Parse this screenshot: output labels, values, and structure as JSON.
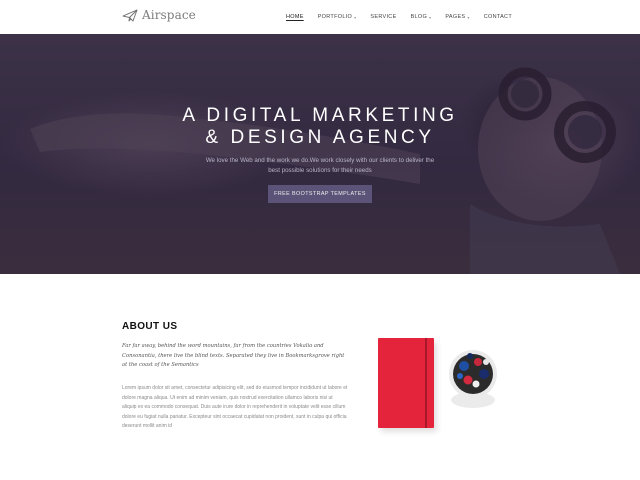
{
  "header": {
    "logo_text": "Airspace",
    "nav": [
      {
        "label": "HOME",
        "active": true,
        "dropdown": false
      },
      {
        "label": "PORTFOLIO",
        "active": false,
        "dropdown": true
      },
      {
        "label": "SERVICE",
        "active": false,
        "dropdown": false
      },
      {
        "label": "BLOG",
        "active": false,
        "dropdown": true
      },
      {
        "label": "PAGES",
        "active": false,
        "dropdown": true
      },
      {
        "label": "CONTACT",
        "active": false,
        "dropdown": false
      }
    ]
  },
  "hero": {
    "title_line1": "A DIGITAL MARKETING",
    "title_line2": "& DESIGN AGENCY",
    "subtitle": "We love the Web and the work we do.We work closely with our clients to deliver the best possible solutions for their needs",
    "button_label": "FREE BOOTSTRAP TEMPLATES"
  },
  "about": {
    "title": "ABOUT US",
    "intro": "Far far away, behind the word mountains, far from the countries Vokalia and Consonantia, there live the blind texts. Separated they live in Bookmarksgrove right at the coast of the Semantics",
    "body": "Lorem ipsum dolor sit amet, consectetur adipisicing elit, sed do eiusmod tempor incididunt ut labore et dolore magna aliqua. Ut enim ad minim veniam, quis nostrud exercitation ullamco laboris nisi ut aliquip ex ea commodo consequat. Duis aute irure dolor in reprehenderit in voluptate velit esse cillum dolore eu fugiat nulla pariatur. Excepteur sint occaecat cupidatat non proident, sunt in culpa qui officia deserunt mollit anim id"
  },
  "colors": {
    "accent_button": "#5c5478",
    "notebook": "#e3243a"
  },
  "icons": {
    "logo": "paper-plane-icon",
    "dropdown": "chevron-down-icon"
  }
}
